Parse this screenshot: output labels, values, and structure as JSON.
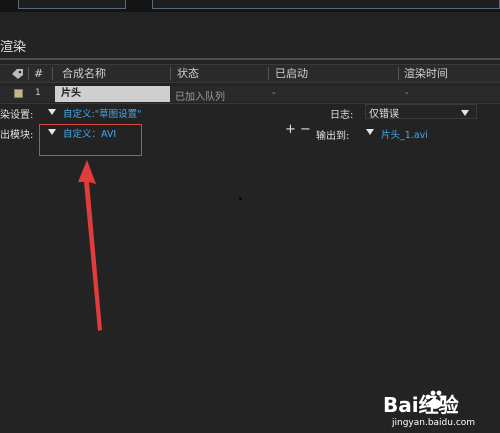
{
  "panel": {
    "title": "渲染"
  },
  "columns": {
    "tag_icon": "tag-icon",
    "num": "#",
    "name": "合成名称",
    "status": "状态",
    "started": "已启动",
    "render_time": "渲染时间"
  },
  "row": {
    "number": "1",
    "name": "片头",
    "status": "已加入队列",
    "started": "-",
    "render_time": "-",
    "checkbox_color": "#c6b58f"
  },
  "settings": {
    "render_label": "染设置:",
    "render_value": "自定义:\"草图设置\"",
    "output_module_label": "出模块:",
    "output_module_value": "自定义：AVI",
    "log_label": "日志:",
    "log_value": "仅错误",
    "output_to_label": "输出到:",
    "output_to_value": "片头_1.avi",
    "plus": "+",
    "minus": "−"
  },
  "colors": {
    "link_blue": "#4aa7e6",
    "highlight_red": "#d9443f"
  },
  "watermark": {
    "text": "Bai经验",
    "url": "jingyan.baidu.com"
  }
}
